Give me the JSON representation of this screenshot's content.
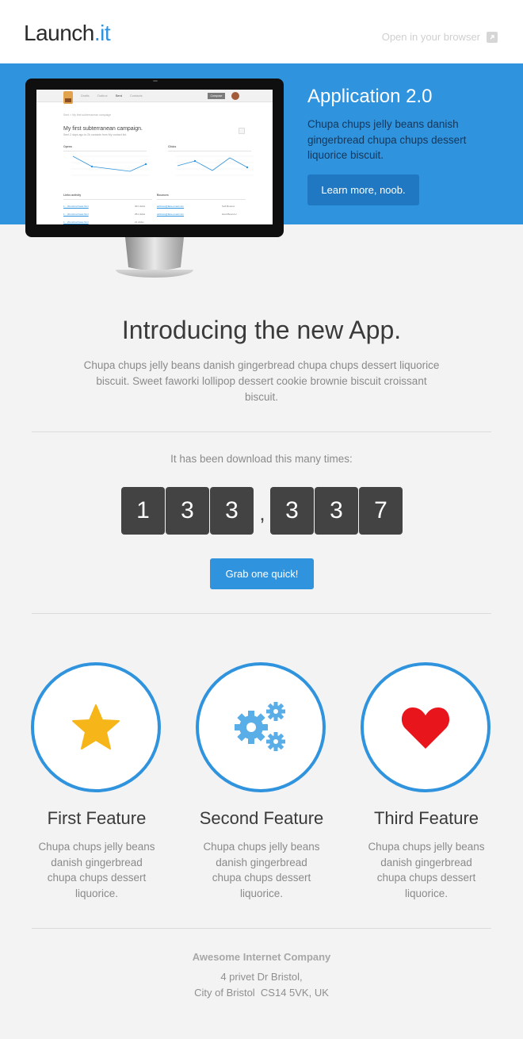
{
  "header": {
    "logo_main": "Launch",
    "logo_accent": ".it",
    "open_in_browser": "Open in your browser",
    "external_link_icon": "external-link-icon"
  },
  "hero": {
    "title": "Application 2.0",
    "text": "Chupa chups jelly beans danish gingerbread chupa chups dessert liquorice biscuit.",
    "button": "Learn more, noob.",
    "bg_color": "#2f93de"
  },
  "screen": {
    "nav_links": [
      "Drafts",
      "Outbox",
      "Sent",
      "Contacts"
    ],
    "compose": "Compose",
    "crumb": "Sent > My first subterranean campaign",
    "title": "My first subterranean campaign.",
    "subtitle": "Sent 2 days ago to 2k contacts from My contact list.",
    "opens_label": "Opens",
    "clicks_label": "Clicks",
    "links_label": "Links activity",
    "bounces_label": "Bounces",
    "links": [
      "1... 2bundnochwas.html",
      "1... 2bundnochwas.html",
      "1... 2bundnochwas.html"
    ],
    "link_counts": [
      "301 clicks",
      "251 clicks",
      "21 clicks"
    ],
    "bounce_emails": [
      "address@fake-email.com",
      "address@fake-email.com"
    ],
    "bounce_types": [
      "Soft Bounce",
      "Hard Bounce !"
    ]
  },
  "intro": {
    "title": "Introducing the new App.",
    "text": "Chupa chups jelly beans danish gingerbread chupa chups dessert liquorice biscuit. Sweet faworki lollipop dessert cookie brownie biscuit croissant biscuit."
  },
  "counter": {
    "caption": "It has been download this many times:",
    "digits": [
      "1",
      "3",
      "3",
      "3",
      "3",
      "7"
    ],
    "separator": ",",
    "button": "Grab one quick!"
  },
  "features": [
    {
      "icon": "star-icon",
      "title": "First Feature",
      "text": "Chupa chups jelly beans danish gingerbread chupa chups dessert liquorice.",
      "icon_color": "#f6b518"
    },
    {
      "icon": "gears-icon",
      "title": "Second Feature",
      "text": "Chupa chups jelly beans danish gingerbread chupa chups dessert liquorice.",
      "icon_color": "#5aaee8"
    },
    {
      "icon": "heart-icon",
      "title": "Third Feature",
      "text": "Chupa chups jelly beans danish gingerbread chupa chups dessert liquorice.",
      "icon_color": "#e8161c"
    }
  ],
  "footer": {
    "company": "Awesome Internet Company",
    "address_line1": "4 privet Dr Bristol,",
    "address_line2": "City of Bristol  CS14 5VK, UK"
  },
  "colors": {
    "accent": "#2f93de",
    "page_bg": "#f3f3f4",
    "digit_bg": "#434343"
  }
}
